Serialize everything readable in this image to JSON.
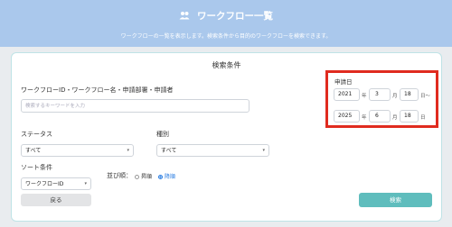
{
  "header": {
    "title": "ワークフロー一覧",
    "description": "ワークフローの一覧を表示します。検索条件から目的のワークフローを検索できます。"
  },
  "search": {
    "title": "検索条件",
    "keyword_label": "ワークフローID・ワークフロー名・申請部署・申請者",
    "keyword_placeholder": "検索するキーワードを入力",
    "status_label": "ステータス",
    "status_value": "すべて",
    "type_label": "種別",
    "type_value": "すべて",
    "sort_label": "ソート条件",
    "sort_value": "ワークフローID",
    "order_label": "並び順：",
    "order_asc": "昇順",
    "order_desc": "降順",
    "order_selected": "desc",
    "back_button": "戻る",
    "search_button": "検索"
  },
  "date": {
    "label": "申請日",
    "from": {
      "year": "2021",
      "month": "3",
      "day": "18"
    },
    "to": {
      "year": "2025",
      "month": "6",
      "day": "18"
    },
    "unit_year": "年",
    "unit_month": "月",
    "unit_day_from": "日〜",
    "unit_day_to": "日"
  },
  "colors": {
    "header_bg": "#aac8ec",
    "search_button": "#5fbdbd",
    "highlight_border": "#e02b1f"
  }
}
